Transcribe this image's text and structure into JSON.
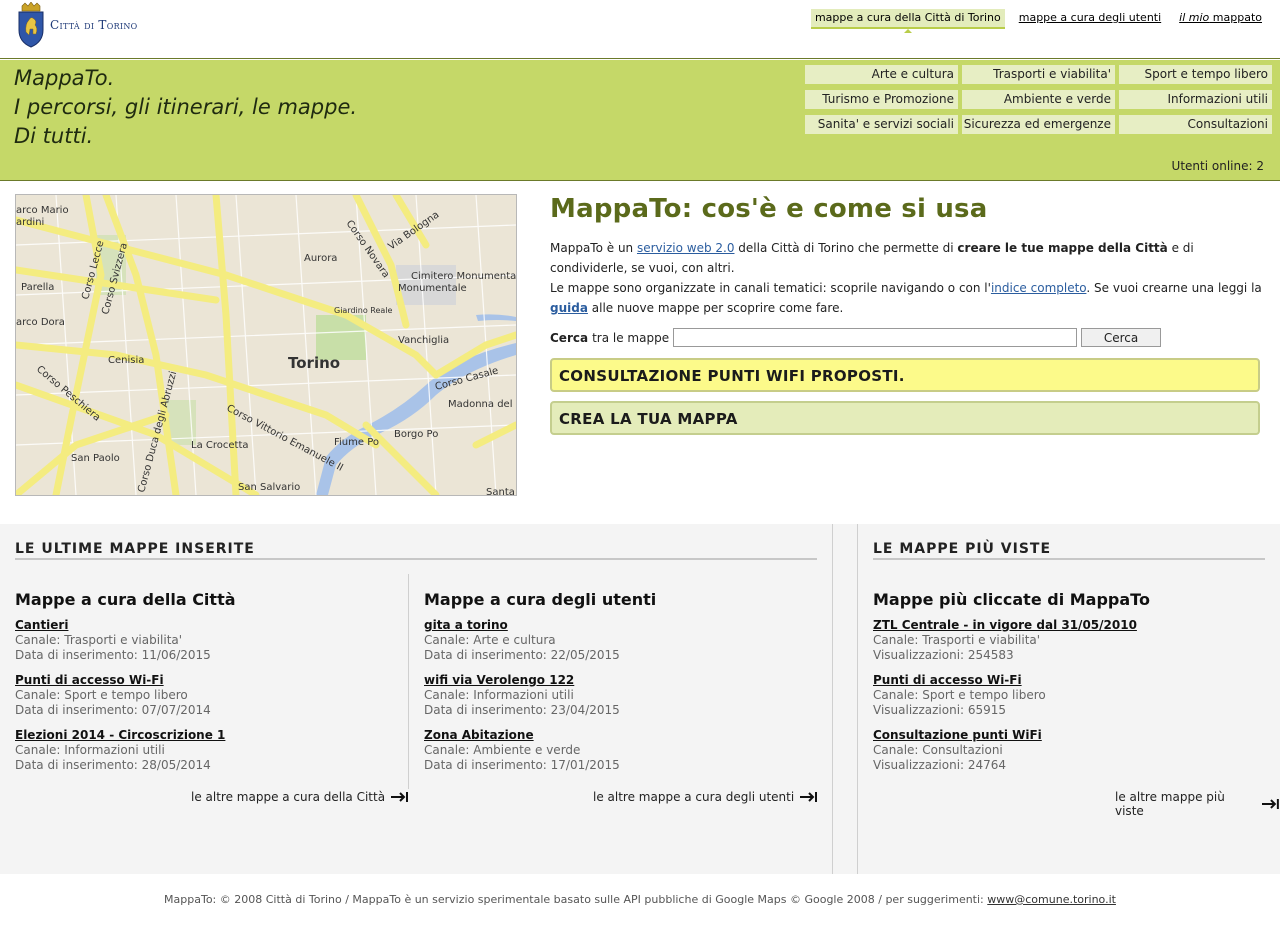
{
  "header": {
    "logo_text": "Città di Torino",
    "links": [
      {
        "label": "mappe a cura della Città di Torino"
      },
      {
        "label": "mappe a cura degli utenti"
      },
      {
        "label_italic": "il mio",
        "label_rest": " mappato"
      }
    ]
  },
  "banner": {
    "tagline": [
      "MappaTo.",
      "I percorsi, gli itinerari, le mappe.",
      "Di tutti."
    ],
    "channels": [
      "Arte e cultura",
      "Trasporti e viabilita'",
      "Sport e tempo libero",
      "Turismo e Promozione",
      "Ambiente e verde",
      "Informazioni utili",
      "Sanita' e servizi sociali",
      "Sicurezza ed emergenze",
      "Consultazioni"
    ],
    "online_label": "Utenti online:",
    "online_count": "2"
  },
  "map": {
    "labels": [
      "arco Mario",
      "ardini",
      "Corso Lecce",
      "Corso Svizzera",
      "Parella",
      "arco Dora",
      "Cenisia",
      "Corso Peschiera",
      "San Paolo",
      "La Crocetta",
      "Corso Duca degli Abruzzi",
      "Corso Vittorio Emanuele II",
      "San Salvario",
      "Torino",
      "Aurora",
      "Corso Novara",
      "Via Bologna",
      "Cimitero Monumentale",
      "Giardino Reale",
      "Vanchiglia",
      "Corso Casale",
      "Madonna del Pilone",
      "Borgo Po",
      "Fiume Po",
      "Santa"
    ]
  },
  "intro": {
    "title": "MappaTo: cos'è e come si usa",
    "p1_a": "MappaTo è un ",
    "p1_link": "servizio web 2.0",
    "p1_b": " della Città di Torino che permette di ",
    "p1_bold": "creare le tue mappe della Città",
    "p1_c": " e di condividerle, se vuoi, con altri.",
    "p2_a": "Le mappe sono organizzate in canali tematici: scoprile navigando o con l'",
    "p2_link": "indice completo",
    "p2_b": ". Se vuoi crearne una leggi la ",
    "p2_link2": "guida",
    "p2_c": " alle nuove mappe per scoprire come fare.",
    "search_bold": "Cerca",
    "search_label": " tra le mappe",
    "search_value": "",
    "search_button": "Cerca",
    "box_wifi": "CONSULTAZIONE PUNTI WIFI PROPOSTI.",
    "box_crea": "CREA LA TUA MAPPA"
  },
  "latest": {
    "title": "LE ULTIME MAPPE INSERITE",
    "city": {
      "title": "Mappe a cura della Città",
      "items": [
        {
          "name": "Cantieri",
          "channel": "Canale: Trasporti e viabilita'",
          "date": "Data di inserimento: 11/06/2015"
        },
        {
          "name": "Punti di accesso Wi-Fi",
          "channel": "Canale: Sport e tempo libero",
          "date": "Data di inserimento: 07/07/2014"
        },
        {
          "name": "Elezioni 2014 - Circoscrizione 1",
          "channel": "Canale: Informazioni utili",
          "date": "Data di inserimento: 28/05/2014"
        }
      ],
      "more": "le altre mappe a cura della Città"
    },
    "users": {
      "title": "Mappe a cura degli utenti",
      "items": [
        {
          "name": "gita a torino",
          "channel": "Canale: Arte e cultura",
          "date": "Data di inserimento: 22/05/2015"
        },
        {
          "name": "wifi via Verolengo 122",
          "channel": "Canale: Informazioni utili",
          "date": "Data di inserimento: 23/04/2015"
        },
        {
          "name": "Zona Abitazione",
          "channel": "Canale: Ambiente e verde",
          "date": "Data di inserimento: 17/01/2015"
        }
      ],
      "more": "le altre mappe a cura degli utenti"
    }
  },
  "viewed": {
    "title": "LE MAPPE PIÙ VISTE",
    "col_title": "Mappe più cliccate di MappaTo",
    "items": [
      {
        "name": "ZTL Centrale - in vigore dal 31/05/2010",
        "channel": "Canale: Trasporti e viabilita'",
        "views": "Visualizzazioni: 254583"
      },
      {
        "name": "Punti di accesso Wi-Fi",
        "channel": "Canale: Sport e tempo libero",
        "views": "Visualizzazioni: 65915"
      },
      {
        "name": "Consultazione punti WiFi",
        "channel": "Canale: Consultazioni",
        "views": "Visualizzazioni: 24764"
      }
    ],
    "more": "le altre mappe più viste"
  },
  "footer": {
    "text": "MappaTo: © 2008 Città di Torino / MappaTo è un servizio sperimentale basato sulle API pubbliche di Google Maps © Google 2008 / per suggerimenti: ",
    "email": "www@comune.torino.it"
  }
}
